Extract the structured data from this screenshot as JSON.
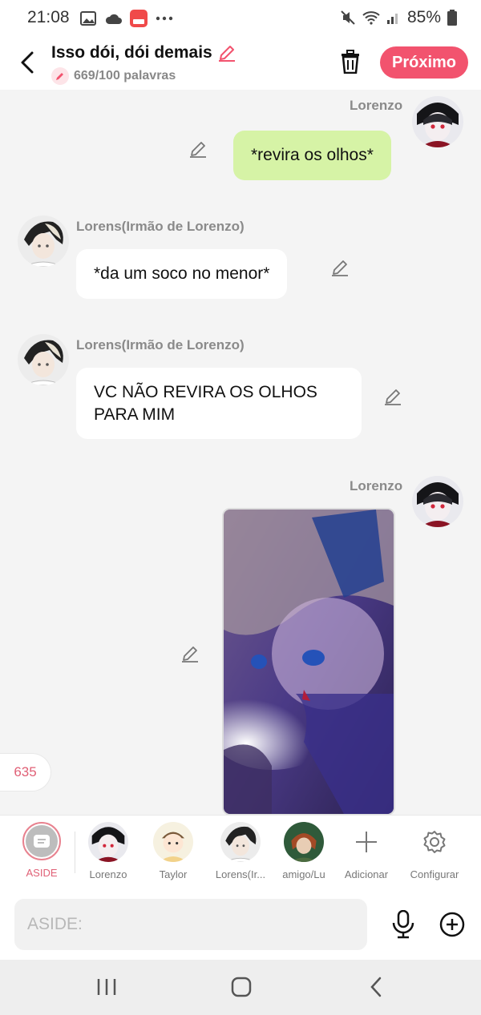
{
  "status_bar": {
    "time": "21:08",
    "battery": "85%"
  },
  "header": {
    "title": "Isso dói, dói demais",
    "word_count": "669/100 palavras",
    "next_label": "Próximo"
  },
  "messages": [
    {
      "sender": "Lorenzo",
      "text": "*revira os olhos*",
      "side": "right"
    },
    {
      "sender": "Lorens(Irmão de Lorenzo)",
      "text": "*da um soco no menor*",
      "side": "left"
    },
    {
      "sender": "Lorens(Irmão de Lorenzo)",
      "text": "VC NÃO REVIRA OS OLHOS PARA MIM",
      "side": "left"
    },
    {
      "sender": "Lorenzo",
      "type": "image",
      "side": "right"
    }
  ],
  "counter": "635",
  "characters": [
    {
      "label": "ASIDE",
      "selected": true
    },
    {
      "label": "Lorenzo"
    },
    {
      "label": "Taylor"
    },
    {
      "label": "Lorens(Ir..."
    },
    {
      "label": "amigo/Lu"
    },
    {
      "label": "Adicionar"
    },
    {
      "label": "Configurar"
    }
  ],
  "input": {
    "placeholder": "ASIDE:"
  },
  "colors": {
    "accent": "#f2536e",
    "bubble_green": "#d6f3a6",
    "bubble_white": "#ffffff",
    "background": "#f4f4f4"
  }
}
